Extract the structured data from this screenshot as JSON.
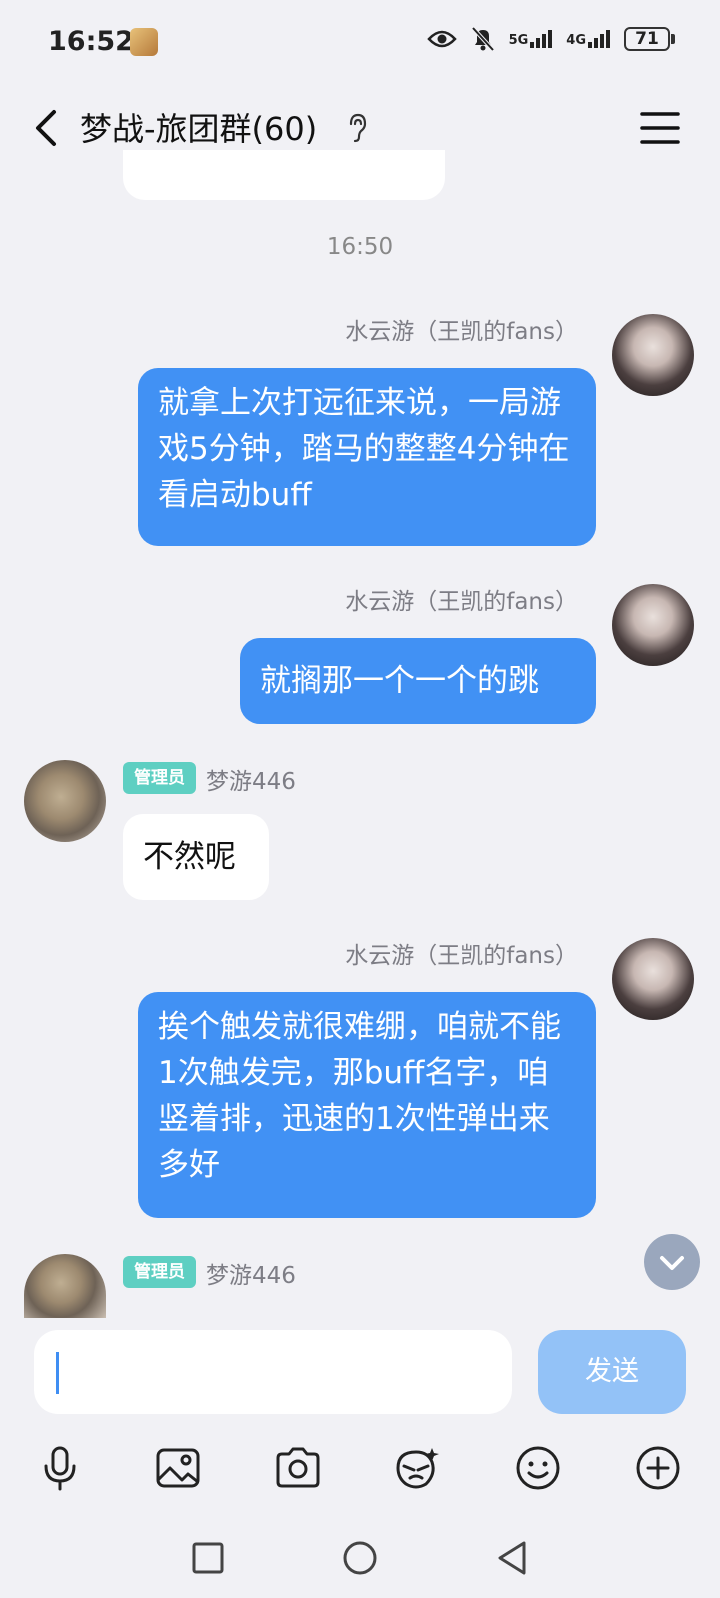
{
  "status_bar": {
    "time": "16:52",
    "net1": "5G",
    "net2": "4G",
    "battery": "71"
  },
  "header": {
    "title": "梦战-旅团群(60)"
  },
  "timestamp": "16:50",
  "messages": [
    {
      "sender": "水云游（王凯的fans）",
      "text": "就拿上次打远征来说，一局游戏5分钟，踏马的整整4分钟在看启动buff"
    },
    {
      "sender": "水云游（王凯的fans）",
      "text": "就搁那一个一个的跳"
    },
    {
      "badge": "管理员",
      "sender": "梦游446",
      "text": "不然呢"
    },
    {
      "sender": "水云游（王凯的fans）",
      "text": "挨个触发就很难绷，咱就不能1次触发完，那buff名字，咱竖着排，迅速的1次性弹出来多好"
    },
    {
      "badge": "管理员",
      "sender": "梦游446"
    }
  ],
  "input": {
    "send_label": "发送"
  },
  "colors": {
    "bubble_blue": "#4191f4",
    "badge": "#5ecfc2",
    "send": "#93c2f7",
    "background": "#f1f1f5"
  },
  "icons": [
    "back-chevron-icon",
    "ear-icon",
    "menu-icon",
    "microphone-icon",
    "image-icon",
    "camera-icon",
    "emoji-face-icon",
    "smiley-icon",
    "plus-icon",
    "chevron-down-icon",
    "square-nav-icon",
    "circle-nav-icon",
    "triangle-back-nav-icon"
  ]
}
